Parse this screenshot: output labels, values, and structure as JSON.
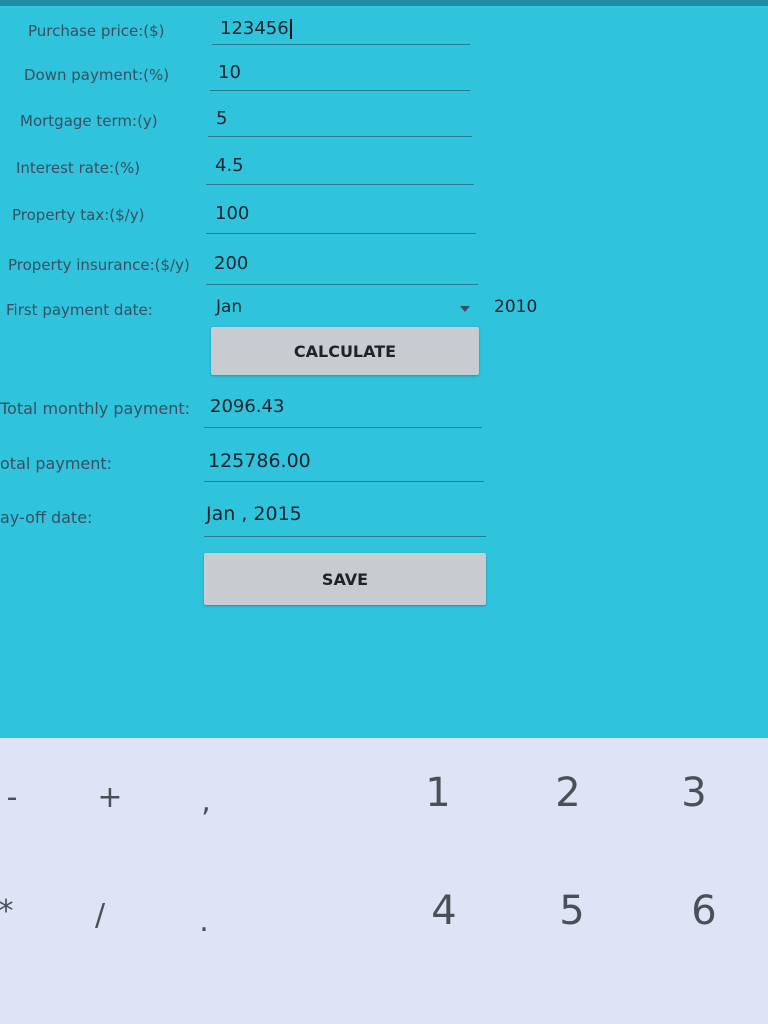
{
  "form": {
    "purchase_price": {
      "label": "Purchase price:($)",
      "value": "123456"
    },
    "down_payment": {
      "label": "Down payment:(%)",
      "value": "10"
    },
    "mortgage_term": {
      "label": "Mortgage term:(y)",
      "value": "5"
    },
    "interest_rate": {
      "label": "Interest rate:(%)",
      "value": "4.5"
    },
    "property_tax": {
      "label": "Property tax:($/y)",
      "value": "100"
    },
    "property_insurance": {
      "label": "Property insurance:($/y)",
      "value": "200"
    },
    "first_payment_date": {
      "label": "First payment date:",
      "month": "Jan",
      "year": "2010"
    }
  },
  "buttons": {
    "calculate": "CALCULATE",
    "save": "SAVE"
  },
  "results": {
    "total_monthly": {
      "label": "Total monthly payment:",
      "value": "2096.43"
    },
    "total_payment": {
      "label": "otal payment:",
      "value": "125786.00"
    },
    "payoff_date": {
      "label": "ay-off date:",
      "value": "Jan , 2015"
    }
  },
  "keyboard": {
    "row1": [
      "-",
      "+",
      ",",
      "1",
      "2",
      "3"
    ],
    "row2": [
      "*",
      "/",
      ".",
      "4",
      "5",
      "6"
    ]
  },
  "colors": {
    "background": "#2fc3dc",
    "keyboard": "#dfe3f6",
    "button": "#c8cbcf"
  }
}
